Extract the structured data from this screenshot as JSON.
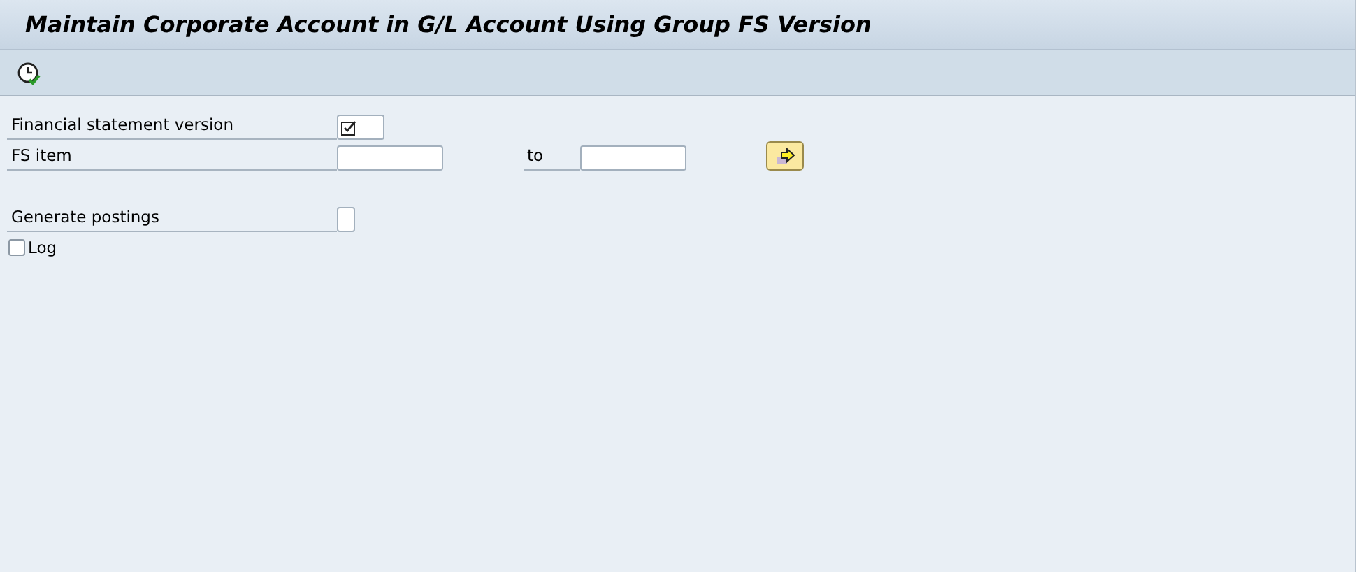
{
  "window": {
    "title": "Maintain Corporate Account in G/L Account Using Group FS Version"
  },
  "toolbar": {
    "execute_button": {
      "kind": "execute"
    }
  },
  "fields": [
    {
      "label": "Financial statement version",
      "kind": "required"
    },
    {
      "label": "FS item",
      "kind": "range",
      "to_label": "to"
    },
    {
      "label": "Generate postings",
      "kind": "flag"
    }
  ],
  "checkboxes": [
    {
      "label": "Log",
      "checked": false
    }
  ]
}
